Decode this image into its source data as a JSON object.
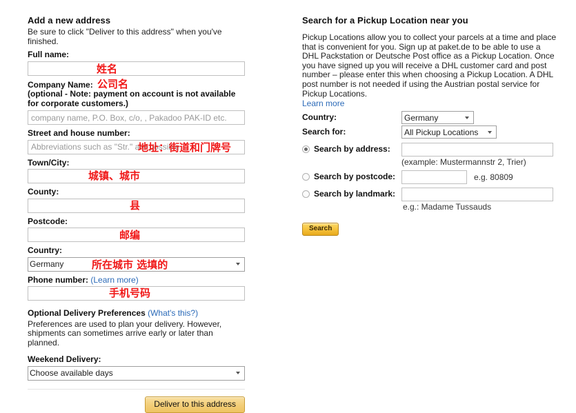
{
  "left": {
    "title": "Add a new address",
    "intro": "Be sure to click \"Deliver to this address\" when you've finished.",
    "full_name_label": "Full name:",
    "full_name_value": "",
    "full_name_annotation": "姓名",
    "company_label": "Company Name:",
    "company_annotation": "公司名",
    "company_note": "(optional - Note: payment on account is not available for corporate customers.)",
    "company_placeholder": "company name, P.O. Box, c/o, , Pakadoo PAK-ID etc.",
    "company_value": "",
    "street_label": "Street and house number:",
    "street_placeholder": "Abbreviations such as \"Str.\" are possible.",
    "street_value": "",
    "street_annotation": "地址：街道和门牌号",
    "town_label": "Town/City:",
    "town_value": "",
    "town_annotation": "城镇、城市",
    "county_label": "County:",
    "county_value": "",
    "county_annotation": "县",
    "postcode_label": "Postcode:",
    "postcode_value": "",
    "postcode_annotation": "邮编",
    "country_label": "Country:",
    "country_value": "Germany",
    "country_annotation": "所在城市 选填的",
    "phone_label": "Phone number:",
    "phone_learn_more": "(Learn more)",
    "phone_value": "",
    "phone_annotation": "手机号码",
    "prefs_title": "Optional Delivery Preferences",
    "prefs_whats_this": "(What's this?)",
    "prefs_desc": "Preferences are used to plan your delivery. However, shipments can sometimes arrive early or later than planned.",
    "weekend_label": "Weekend Delivery:",
    "weekend_value": "Choose available days",
    "deliver_button": "Deliver to this address"
  },
  "right": {
    "title": "Search for a Pickup Location near you",
    "description": "Pickup Locations allow you to collect your parcels at a time and place that is convenient for you. Sign up at paket.de to be able to use a DHL Packstation or Deutsche Post office as a Pickup Location. Once you have signed up you will receive a DHL customer card and post number – please enter this when choosing a Pickup Location. A DHL post number is not needed if using the Austrian postal service for Pickup Locations.",
    "learn_more": "Learn more",
    "country_label": "Country:",
    "country_value": "Germany",
    "search_for_label": "Search for:",
    "search_for_value": "All Pickup Locations",
    "by_address_label": "Search by address:",
    "by_address_value": "",
    "by_address_example": "(example: Mustermannstr 2, Trier)",
    "by_postcode_label": "Search by postcode:",
    "by_postcode_value": "",
    "by_postcode_example": "e.g. 80809",
    "by_landmark_label": "Search by landmark:",
    "by_landmark_value": "",
    "by_landmark_example": "e.g.: Madame Tussauds",
    "search_button": "Search",
    "selected_option": "address"
  },
  "colors": {
    "annotation_red": "#f01818",
    "link_blue": "#2b6ab8",
    "button_gold": "#f3cf7a",
    "search_gold": "#f6c440"
  }
}
